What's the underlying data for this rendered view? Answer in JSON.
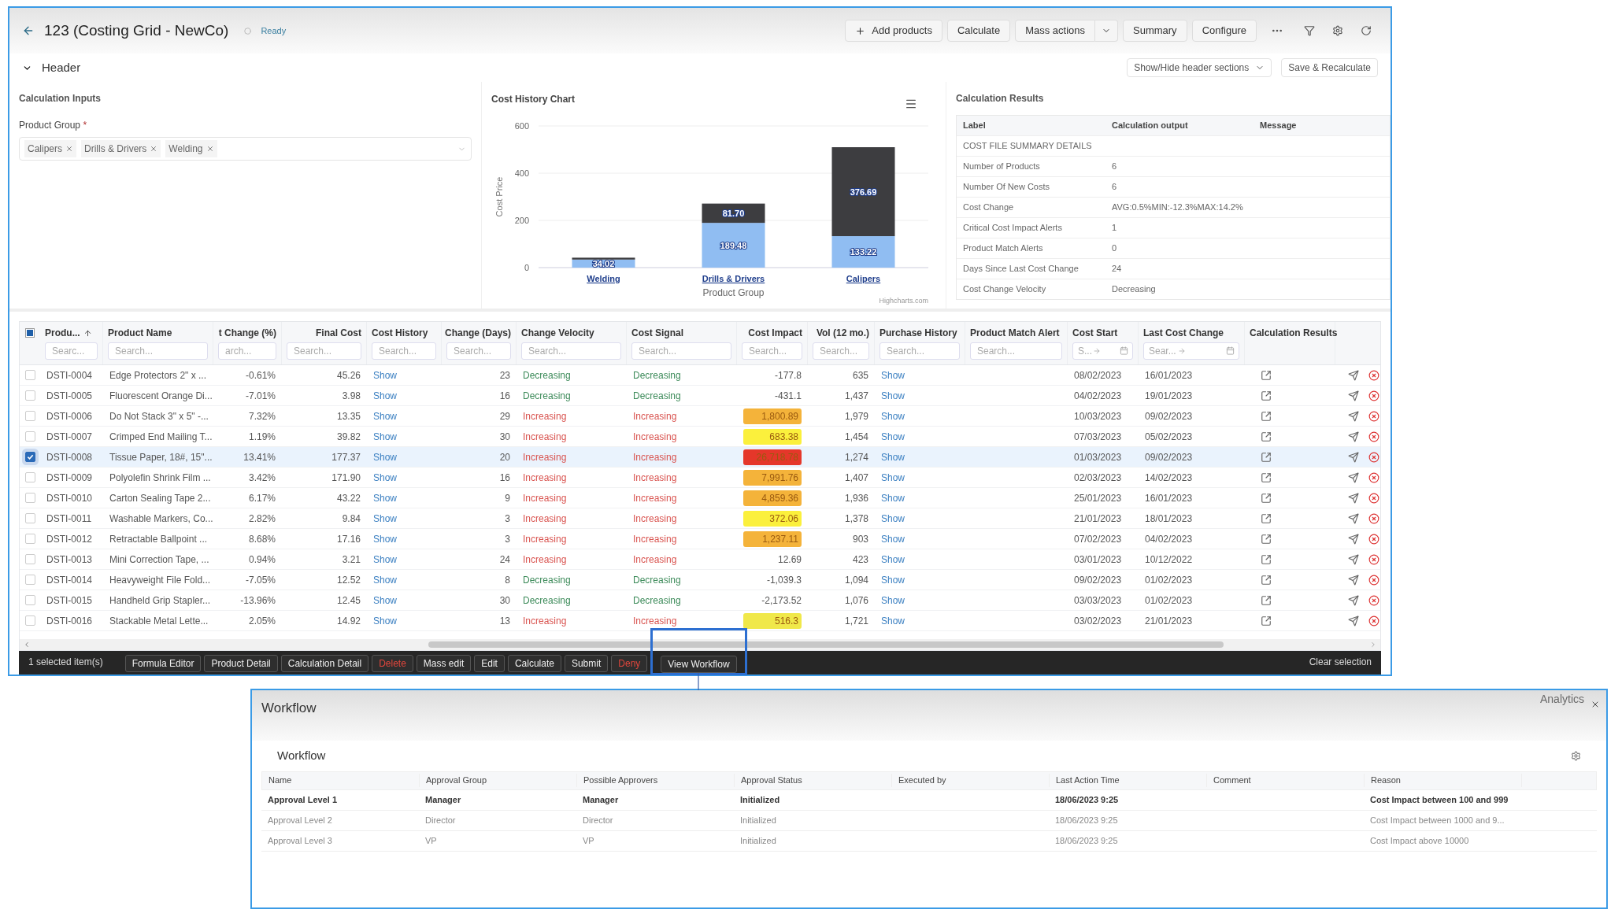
{
  "window": {
    "title": "123 (Costing Grid - NewCo)",
    "status": "Ready"
  },
  "toolbar": [
    {
      "label": "Add products",
      "kind": "add"
    },
    {
      "label": "Calculate",
      "kind": "plain"
    },
    {
      "label": "Mass actions",
      "kind": "split"
    },
    {
      "label": "Summary",
      "kind": "plain"
    },
    {
      "label": "Configure",
      "kind": "plain"
    }
  ],
  "header_section": {
    "title": "Header",
    "expanded": true,
    "show_hide": "Show/Hide header sections",
    "save": "Save & Recalculate"
  },
  "calculation_inputs": {
    "title": "Calculation Inputs",
    "field_label": "Product Group",
    "required_mark": "*",
    "tags": [
      "Calipers",
      "Drills & Drivers",
      "Welding"
    ]
  },
  "cost_history": {
    "credit": "Highcharts.com",
    "chart_data": {
      "type": "bar",
      "title": "Cost History Chart",
      "xlabel": "Product Group",
      "ylabel": "Cost Price",
      "categories": [
        "Welding",
        "Drills & Drivers",
        "Calipers"
      ],
      "stacked": true,
      "ylim": [
        0,
        600
      ],
      "yticks": [
        0,
        200,
        400,
        600
      ],
      "series": [
        {
          "color": "#3d3d40",
          "values": [
            8,
            81.7,
            376.69
          ],
          "value_labels": [
            null,
            "81.70",
            "376.69"
          ]
        },
        {
          "color": "#90bdf2",
          "values": [
            34.02,
            189.48,
            133.22
          ],
          "value_labels": [
            "34.02",
            "189.48",
            "133.22"
          ]
        }
      ]
    }
  },
  "calculation_results": {
    "title": "Calculation Results",
    "columns": [
      "Label",
      "Calculation output",
      "Message"
    ],
    "rows": [
      {
        "label": "COST FILE SUMMARY DETAILS"
      },
      {
        "label": "Number of Products",
        "output": "6"
      },
      {
        "label": "Number Of New Costs",
        "output": "6"
      },
      {
        "label": "Cost Change",
        "output": "AVG:0.5%MIN:-12.3%MAX:14.2%"
      },
      {
        "label": "Critical Cost Impact Alerts",
        "output": "1"
      },
      {
        "label": "Product Match Alerts",
        "output": "0"
      },
      {
        "label": "Days Since Last Cost Change",
        "output": "24"
      },
      {
        "label": "Cost Change Velocity",
        "output": "Decreasing"
      }
    ]
  },
  "grid": {
    "some_selected": true,
    "columns": [
      {
        "label": "Produ...",
        "placeholder": "Searc...",
        "sorted": true
      },
      {
        "label": "Product Name",
        "placeholder": "Search...",
        "sorted": false
      },
      {
        "label": "t Change (%)",
        "placeholder": "arch...",
        "sorted": false
      },
      {
        "label": "Final Cost",
        "placeholder": "Search...",
        "sorted": false
      },
      {
        "label": "Cost History",
        "placeholder": "Search...",
        "sorted": false
      },
      {
        "label": "Change (Days)",
        "placeholder": "Search...",
        "sorted": false
      },
      {
        "label": "Change Velocity",
        "placeholder": "Search...",
        "sorted": false
      },
      {
        "label": "Cost Signal",
        "placeholder": "Search...",
        "sorted": false
      },
      {
        "label": "Cost Impact",
        "placeholder": "Search...",
        "sorted": false
      },
      {
        "label": "Vol (12 mo.)",
        "placeholder": "Search...",
        "sorted": false
      },
      {
        "label": "Purchase History",
        "placeholder": "Search...",
        "sorted": false
      },
      {
        "label": "Product Match Alert",
        "placeholder": "Search...",
        "sorted": false
      },
      {
        "label": "Cost Start",
        "placeholder": "S...",
        "kind": "date",
        "sorted": false
      },
      {
        "label": "Last Cost Change",
        "placeholder": "Sear...",
        "kind": "date",
        "sorted": false
      },
      {
        "label": "Calculation Results",
        "sorted": false
      }
    ],
    "rows": [
      {
        "selected": false,
        "id": "DSTI-0004",
        "name": "Edge Protectors 2\" x ...",
        "change": "-0.61%",
        "final_cost": "45.26",
        "history": "Show",
        "days": "23",
        "velocity": "Decreasing",
        "signal": "Decreasing",
        "increasing": false,
        "impact": {
          "value": "-177.8"
        },
        "vol": "635",
        "purchase": "Show",
        "cost_start": "08/02/2023",
        "last_change": "16/01/2023"
      },
      {
        "selected": false,
        "id": "DSTI-0005",
        "name": "Fluorescent Orange Di...",
        "change": "-7.01%",
        "final_cost": "3.98",
        "history": "Show",
        "days": "16",
        "velocity": "Decreasing",
        "signal": "Decreasing",
        "increasing": false,
        "impact": {
          "value": "-431.1"
        },
        "vol": "1,437",
        "purchase": "Show",
        "cost_start": "04/02/2023",
        "last_change": "19/01/2023"
      },
      {
        "selected": false,
        "id": "DSTI-0006",
        "name": "Do Not Stack 3\" x 5\" -...",
        "change": "7.32%",
        "final_cost": "13.35",
        "history": "Show",
        "days": "29",
        "velocity": "Increasing",
        "signal": "Increasing",
        "increasing": true,
        "impact": {
          "value": "1,800.89",
          "color": "#f4b33a"
        },
        "vol": "1,979",
        "purchase": "Show",
        "cost_start": "10/03/2023",
        "last_change": "09/02/2023"
      },
      {
        "selected": false,
        "id": "DSTI-0007",
        "name": "Crimped End Mailing T...",
        "change": "1.19%",
        "final_cost": "39.82",
        "history": "Show",
        "days": "30",
        "velocity": "Increasing",
        "signal": "Increasing",
        "increasing": true,
        "impact": {
          "value": "683.38",
          "color": "#fbf03c"
        },
        "vol": "1,454",
        "purchase": "Show",
        "cost_start": "07/03/2023",
        "last_change": "05/02/2023"
      },
      {
        "selected": true,
        "id": "DSTI-0008",
        "name": "Tissue Paper, 18#, 15\"...",
        "change": "13.41%",
        "final_cost": "177.37",
        "history": "Show",
        "days": "20",
        "velocity": "Increasing",
        "signal": "Increasing",
        "increasing": true,
        "impact": {
          "value": "26,718.78",
          "color": "#e5372a"
        },
        "vol": "1,274",
        "purchase": "Show",
        "cost_start": "01/03/2023",
        "last_change": "09/02/2023"
      },
      {
        "selected": false,
        "id": "DSTI-0009",
        "name": "Polyolefin Shrink Film ...",
        "change": "3.42%",
        "final_cost": "171.90",
        "history": "Show",
        "days": "16",
        "velocity": "Increasing",
        "signal": "Increasing",
        "increasing": true,
        "impact": {
          "value": "7,991.76",
          "color": "#f4b33a"
        },
        "vol": "1,407",
        "purchase": "Show",
        "cost_start": "02/03/2023",
        "last_change": "14/02/2023"
      },
      {
        "selected": false,
        "id": "DSTI-0010",
        "name": "Carton Sealing Tape 2...",
        "change": "6.17%",
        "final_cost": "43.22",
        "history": "Show",
        "days": "9",
        "velocity": "Increasing",
        "signal": "Increasing",
        "increasing": true,
        "impact": {
          "value": "4,859.36",
          "color": "#f4b33a"
        },
        "vol": "1,936",
        "purchase": "Show",
        "cost_start": "25/01/2023",
        "last_change": "16/01/2023"
      },
      {
        "selected": false,
        "id": "DSTI-0011",
        "name": "Washable Markers, Co...",
        "change": "2.82%",
        "final_cost": "9.84",
        "history": "Show",
        "days": "3",
        "velocity": "Increasing",
        "signal": "Increasing",
        "increasing": true,
        "impact": {
          "value": "372.06",
          "color": "#fbf03c"
        },
        "vol": "1,378",
        "purchase": "Show",
        "cost_start": "21/01/2023",
        "last_change": "18/01/2023"
      },
      {
        "selected": false,
        "id": "DSTI-0012",
        "name": "Retractable Ballpoint ...",
        "change": "8.68%",
        "final_cost": "17.16",
        "history": "Show",
        "days": "3",
        "velocity": "Increasing",
        "signal": "Increasing",
        "increasing": true,
        "impact": {
          "value": "1,237.11",
          "color": "#f4b33a"
        },
        "vol": "903",
        "purchase": "Show",
        "cost_start": "07/02/2023",
        "last_change": "04/02/2023"
      },
      {
        "selected": false,
        "id": "DSTI-0013",
        "name": "Mini Correction Tape, ...",
        "change": "0.94%",
        "final_cost": "3.21",
        "history": "Show",
        "days": "24",
        "velocity": "Increasing",
        "signal": "Increasing",
        "increasing": true,
        "impact": {
          "value": "12.69"
        },
        "vol": "423",
        "purchase": "Show",
        "cost_start": "03/01/2023",
        "last_change": "10/12/2022"
      },
      {
        "selected": false,
        "id": "DSTI-0014",
        "name": "Heavyweight File Fold...",
        "change": "-7.05%",
        "final_cost": "12.52",
        "history": "Show",
        "days": "8",
        "velocity": "Decreasing",
        "signal": "Decreasing",
        "increasing": false,
        "impact": {
          "value": "-1,039.3"
        },
        "vol": "1,094",
        "purchase": "Show",
        "cost_start": "09/02/2023",
        "last_change": "01/02/2023"
      },
      {
        "selected": false,
        "id": "DSTI-0015",
        "name": "Handheld Grip Stapler...",
        "change": "-13.96%",
        "final_cost": "12.45",
        "history": "Show",
        "days": "30",
        "velocity": "Decreasing",
        "signal": "Decreasing",
        "increasing": false,
        "impact": {
          "value": "-2,173.52"
        },
        "vol": "1,076",
        "purchase": "Show",
        "cost_start": "03/03/2023",
        "last_change": "01/02/2023"
      },
      {
        "selected": false,
        "id": "DSTI-0016",
        "name": "Stackable Metal Lette...",
        "change": "2.05%",
        "final_cost": "14.92",
        "history": "Show",
        "days": "13",
        "velocity": "Increasing",
        "signal": "Increasing",
        "increasing": true,
        "impact": {
          "value": "516.3",
          "color": "#f0e84a"
        },
        "vol": "1,721",
        "purchase": "Show",
        "cost_start": "03/02/2023",
        "last_change": "21/01/2023"
      }
    ]
  },
  "action_bar": {
    "selection": "1 selected item(s)",
    "buttons": [
      {
        "label": "Formula Editor",
        "danger": false,
        "highlighted": false
      },
      {
        "label": "Product Detail",
        "danger": false,
        "highlighted": false
      },
      {
        "label": "Calculation Detail",
        "danger": false,
        "highlighted": false
      },
      {
        "label": "Delete",
        "danger": true,
        "highlighted": false
      },
      {
        "label": "Mass edit",
        "danger": false,
        "highlighted": false
      },
      {
        "label": "Edit",
        "danger": false,
        "highlighted": false
      },
      {
        "label": "Calculate",
        "danger": false,
        "highlighted": false
      },
      {
        "label": "Submit",
        "danger": false,
        "highlighted": false
      },
      {
        "label": "Deny",
        "danger": true,
        "highlighted": false
      },
      {
        "label": "View Workflow",
        "danger": false,
        "highlighted": true
      }
    ],
    "clear": "Clear selection"
  },
  "workflow": {
    "title": "Workflow",
    "corner_label": "Analytics",
    "subtitle": "Workflow",
    "columns": [
      "Name",
      "Approval Group",
      "Possible Approvers",
      "Approval Status",
      "Executed by",
      "Last Action Time",
      "Comment",
      "Reason"
    ],
    "rows": [
      {
        "active": true,
        "name": "Approval Level 1",
        "group": "Manager",
        "approvers": "Manager",
        "status": "Initialized",
        "time": "18/06/2023 9:25",
        "reason": "Cost Impact between 100 and 999"
      },
      {
        "active": false,
        "name": "Approval Level 2",
        "group": "Director",
        "approvers": "Director",
        "status": "Initialized",
        "time": "18/06/2023 9:25",
        "reason": "Cost Impact between 1000 and 9..."
      },
      {
        "active": false,
        "name": "Approval Level 3",
        "group": "VP",
        "approvers": "VP",
        "status": "Initialized",
        "time": "18/06/2023 9:25",
        "reason": "Cost Impact above 10000"
      }
    ]
  }
}
